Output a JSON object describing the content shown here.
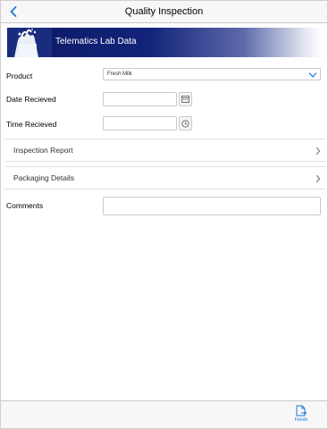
{
  "header": {
    "title": "Quality Inspection",
    "back_icon": "chevron-left-icon"
  },
  "banner": {
    "text": "Telematics Lab Data"
  },
  "form": {
    "product_label": "Product",
    "product_value": "Fresh Milk",
    "date_label": "Date Recieved",
    "date_value": "",
    "time_label": "Time Recieved",
    "time_value": "",
    "comments_label": "Comments",
    "comments_value": ""
  },
  "sections": [
    {
      "label": "Inspection Report"
    },
    {
      "label": "Packaging Details"
    }
  ],
  "toolbar": {
    "finish_label": "Finish"
  },
  "colors": {
    "accent": "#1a7ad4",
    "banner_dark": "#0b1a63"
  }
}
